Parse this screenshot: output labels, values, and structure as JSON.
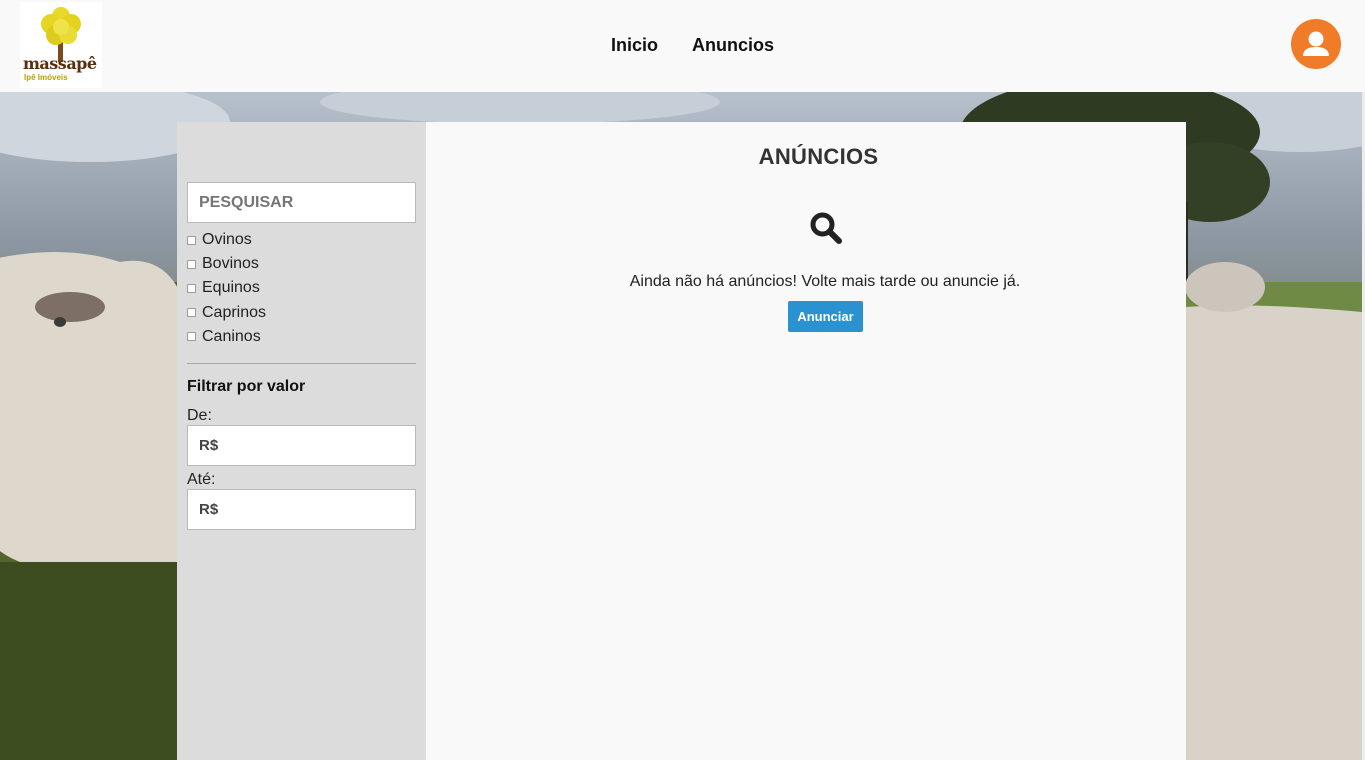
{
  "header": {
    "logo": {
      "name": "massapê",
      "subtitle": "Ipê Imóveis"
    },
    "nav": [
      {
        "label": "Inicio"
      },
      {
        "label": "Anuncios"
      }
    ],
    "avatar_icon": "user-icon",
    "avatar_color": "#f07c2a"
  },
  "sidebar": {
    "search": {
      "placeholder": "PESQUISAR",
      "value": ""
    },
    "categories": [
      {
        "label": "Ovinos",
        "checked": false
      },
      {
        "label": "Bovinos",
        "checked": false
      },
      {
        "label": "Equinos",
        "checked": false
      },
      {
        "label": "Caprinos",
        "checked": false
      },
      {
        "label": "Caninos",
        "checked": false
      }
    ],
    "filter": {
      "title": "Filtrar por valor",
      "from_label": "De:",
      "from_placeholder": "R$",
      "to_label": "Até:",
      "to_placeholder": "R$"
    }
  },
  "main": {
    "title": "ANÚNCIOS",
    "empty_icon": "search-icon",
    "empty_message": "Ainda não há anúncios! Volte mais tarde ou anuncie já.",
    "cta_label": "Anunciar",
    "cta_color": "#2a92d0"
  }
}
